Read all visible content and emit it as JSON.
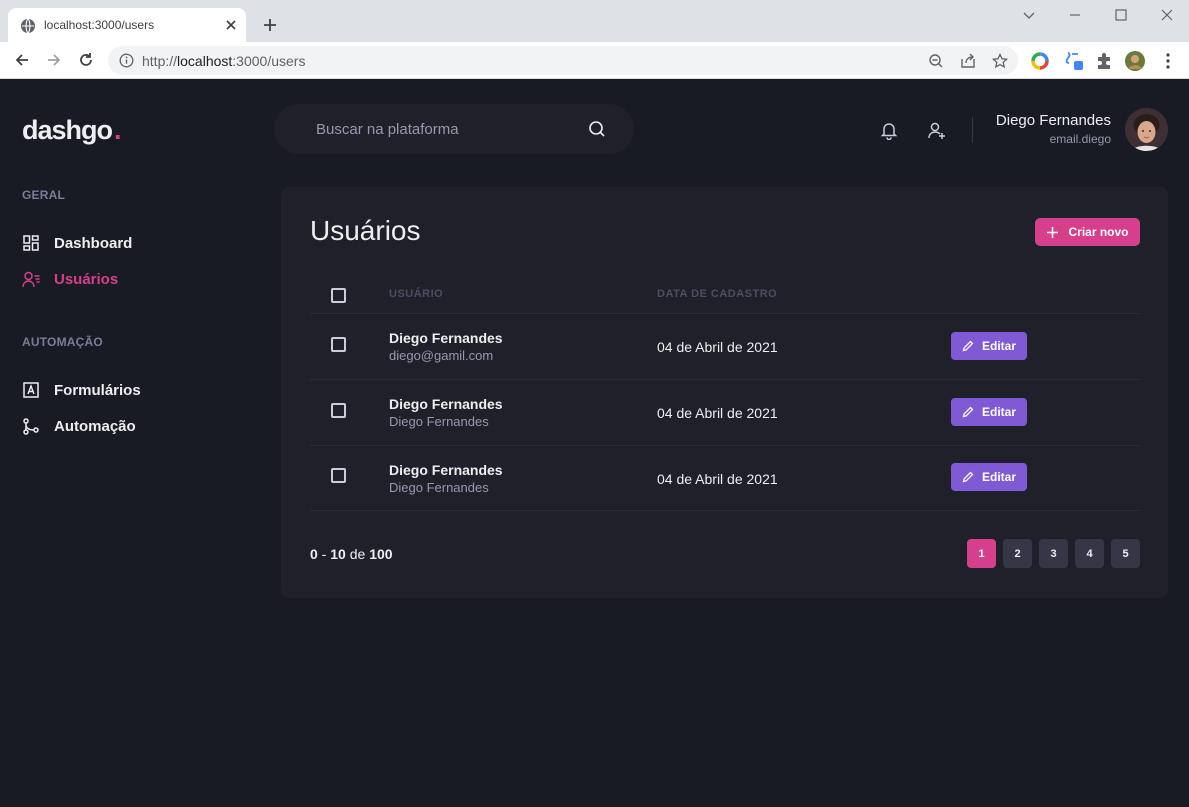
{
  "browser": {
    "tab_title": "localhost:3000/users",
    "url_prefix": "http://",
    "url_host": "localhost",
    "url_path": ":3000/users"
  },
  "app": {
    "logo_text": "dashgo",
    "logo_dot": ".",
    "search_placeholder": "Buscar na plataforma",
    "profile": {
      "name": "Diego Fernandes",
      "email": "email.diego"
    },
    "colors": {
      "background": "#181b23",
      "card": "#1f2029",
      "accent_pink": "#d53f8c",
      "accent_purple": "#805ad5",
      "muted": "#9699b0"
    }
  },
  "sidebar": {
    "sections": [
      {
        "title": "GERAL",
        "items": [
          {
            "label": "Dashboard",
            "icon": "dashboard-icon",
            "active": false
          },
          {
            "label": "Usuários",
            "icon": "users-icon",
            "active": true
          }
        ]
      },
      {
        "title": "AUTOMAÇÃO",
        "items": [
          {
            "label": "Formulários",
            "icon": "form-icon",
            "active": false
          },
          {
            "label": "Automação",
            "icon": "git-branch-icon",
            "active": false
          }
        ]
      }
    ]
  },
  "main": {
    "title": "Usuários",
    "create_button": "Criar novo",
    "columns": [
      "USUÁRIO",
      "DATA DE CADASTRO"
    ],
    "rows": [
      {
        "name": "Diego Fernandes",
        "sub": "diego@gamil.com",
        "date": "04 de Abril de 2021",
        "action": "Editar"
      },
      {
        "name": "Diego Fernandes",
        "sub": "Diego Fernandes",
        "date": "04 de Abril de 2021",
        "action": "Editar"
      },
      {
        "name": "Diego Fernandes",
        "sub": "Diego Fernandes",
        "date": "04 de Abril de 2021",
        "action": "Editar"
      }
    ],
    "pagination": {
      "from": "0",
      "separator": " - ",
      "to": "10",
      "of_word": " de ",
      "total": "100",
      "pages": [
        "1",
        "2",
        "3",
        "4",
        "5"
      ],
      "current_page": "1"
    }
  }
}
